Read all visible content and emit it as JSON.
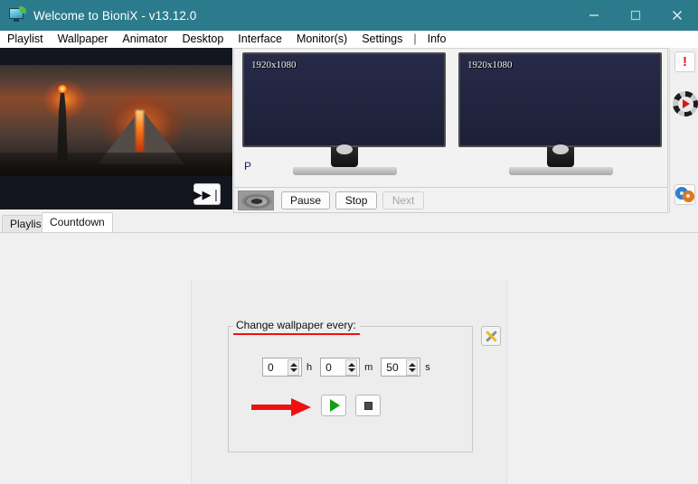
{
  "window": {
    "title": "Welcome to BioniX -  v13.12.0",
    "icon": "monitor-icon",
    "accent_color": "#2b7b8c",
    "controls": {
      "minimize": "minimize-icon",
      "maximize": "maximize-icon",
      "close": "close-icon"
    }
  },
  "menubar": {
    "items": [
      {
        "label": "Playlist"
      },
      {
        "label": "Wallpaper"
      },
      {
        "label": "Animator"
      },
      {
        "label": "Desktop"
      },
      {
        "label": "Interface"
      },
      {
        "label": "Monitor(s)"
      },
      {
        "label": "Settings"
      }
    ],
    "separator": "|",
    "info_label": "Info"
  },
  "preview": {
    "skip_button": "▶▶❘",
    "description": "dark-fantasy-wallpaper"
  },
  "monitors": [
    {
      "resolution": "1920x1080"
    },
    {
      "resolution": "1920x1080"
    }
  ],
  "playlist_label": "P",
  "transport": {
    "thumbnail": "wallpaper-thumbnail",
    "buttons": [
      {
        "label": "Pause",
        "disabled": false
      },
      {
        "label": "Stop",
        "disabled": false
      },
      {
        "label": "Next",
        "disabled": true
      }
    ]
  },
  "rail": {
    "alert_icon": "!",
    "wheel_icon": "playback-wheel-icon",
    "gears_icon": "gears-icon"
  },
  "tabs": [
    {
      "label": "Playlist",
      "active": false
    },
    {
      "label": "Countdown",
      "active": true
    }
  ],
  "countdown": {
    "legend": "Change wallpaper every:",
    "fields": [
      {
        "value": "0",
        "unit": "h"
      },
      {
        "value": "0",
        "unit": "m"
      },
      {
        "value": "50",
        "unit": "s"
      }
    ],
    "start_button": "play-icon",
    "stop_button": "stop-icon",
    "tools_button": "tools-icon",
    "annotation_color": "#ee1111"
  }
}
